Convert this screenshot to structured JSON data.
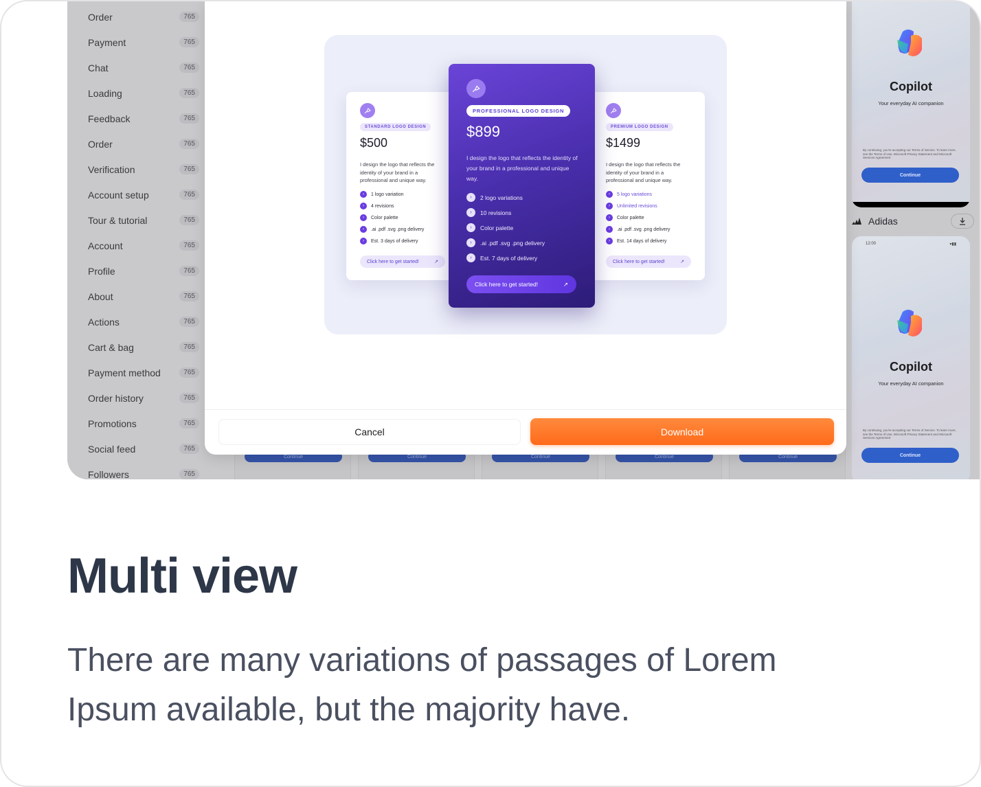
{
  "sidebar": {
    "items": [
      {
        "label": "Order",
        "count": "765"
      },
      {
        "label": "Payment",
        "count": "765"
      },
      {
        "label": "Chat",
        "count": "765"
      },
      {
        "label": "Loading",
        "count": "765"
      },
      {
        "label": "Feedback",
        "count": "765"
      },
      {
        "label": "Order",
        "count": "765"
      },
      {
        "label": "Verification",
        "count": "765"
      },
      {
        "label": "Account setup",
        "count": "765"
      },
      {
        "label": "Tour & tutorial",
        "count": "765"
      },
      {
        "label": "Account",
        "count": "765"
      },
      {
        "label": "Profile",
        "count": "765"
      },
      {
        "label": "About",
        "count": "765"
      },
      {
        "label": "Actions",
        "count": "765"
      },
      {
        "label": "Cart & bag",
        "count": "765"
      },
      {
        "label": "Payment method",
        "count": "765"
      },
      {
        "label": "Order history",
        "count": "765"
      },
      {
        "label": "Promotions",
        "count": "765"
      },
      {
        "label": "Social feed",
        "count": "765"
      },
      {
        "label": "Followers",
        "count": "765"
      }
    ]
  },
  "thumbnails": {
    "button_label": "Continue"
  },
  "pricing": {
    "standard": {
      "tag": "STANDARD LOGO DESIGN",
      "price": "$500",
      "description": "I design the logo that reflects the identity of your brand in a professional and unique way.",
      "features": [
        "1 logo variation",
        "4 revisions",
        "Color palette",
        ".ai .pdf .svg .png delivery",
        "Est. 3 days of delivery"
      ],
      "cta": "Click here to get started!"
    },
    "professional": {
      "tag": "PROFESSIONAL LOGO DESIGN",
      "price": "$899",
      "description": "I design the logo that reflects the identity of your brand in a professional and unique way.",
      "features": [
        "2 logo variations",
        "10 revisions",
        "Color palette",
        ".ai .pdf .svg .png delivery",
        "Est. 7 days of delivery"
      ],
      "cta": "Click here to get started!"
    },
    "premium": {
      "tag": "PREMIUM LOGO DESIGN",
      "price": "$1499",
      "description": "I design the logo that reflects the identity of your brand in a professional and unique way.",
      "features": [
        "5 logo variations",
        "Unlimited revisions",
        "Color palette",
        ".ai .pdf .svg .png delivery",
        "Est. 14 days of delivery"
      ],
      "cta": "Click here to get started!"
    }
  },
  "modal": {
    "cancel_label": "Cancel",
    "download_label": "Download"
  },
  "right_panel": {
    "app_title": "Copilot",
    "app_subtitle": "Your everyday AI companion",
    "legal_text": "By continuing, you're accepting our Terms of Service. To learn more, see the Terms of Use, Microsoft Privacy Statement and Microsoft Services Agreement",
    "continue_label": "Continue",
    "app_name": "Adidas",
    "status_time": "12:00"
  },
  "caption": {
    "title": "Multi view",
    "body": "There are many variations of passages of Lorem Ipsum available, but the majority have."
  },
  "colors": {
    "accent_orange": "#ff6a1a",
    "accent_purple": "#5a3fd0",
    "heading": "#2d3748",
    "body": "#4a5060"
  }
}
